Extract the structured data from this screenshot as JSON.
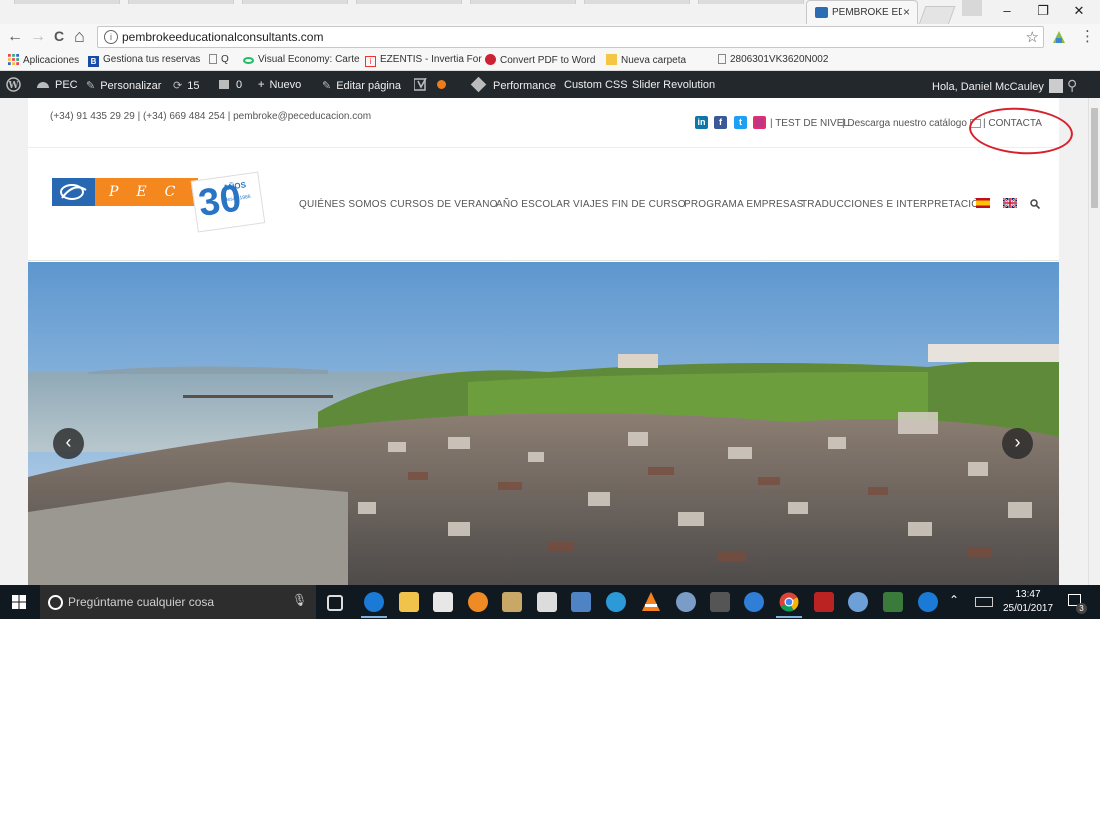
{
  "browser": {
    "tab_title": "PEMBROKE EDU",
    "tab_close": "×",
    "window_controls": {
      "minimize": "–",
      "restore": "❐",
      "close": "✕"
    },
    "nav": {
      "back": "←",
      "forward": "→",
      "reload": "C",
      "home": "⌂"
    },
    "url": "pembrokeeducationalconsultants.com",
    "star": "☆",
    "menu": "⋮"
  },
  "bookmarks": [
    {
      "label": "Aplicaciones",
      "icon": "apps-grid-icon",
      "color": "#e44"
    },
    {
      "label": "Gestiona tus reservas",
      "icon": "booking-icon",
      "color": "#1a4aa8"
    },
    {
      "label": "Q",
      "icon": "page-icon",
      "color": "#888"
    },
    {
      "label": "Visual Economy: Carte",
      "icon": "eye-icon",
      "color": "#2b6"
    },
    {
      "label": "EZENTIS - Invertia For",
      "icon": "invertia-icon",
      "color": "#e33"
    },
    {
      "label": "Convert PDF to Word",
      "icon": "convert-icon",
      "color": "#c23"
    },
    {
      "label": "Nueva carpeta",
      "icon": "folder-icon",
      "color": "#f3c744"
    },
    {
      "label": "2806301VK3620N002",
      "icon": "page-icon",
      "color": "#888"
    }
  ],
  "wp_admin": {
    "site": "PEC",
    "customize": "Personalizar",
    "updates": "15",
    "comments": "0",
    "new": "Nuevo",
    "edit_page": "Editar página",
    "performance": "Performance",
    "custom_css": "Custom CSS",
    "slider": "Slider Revolution",
    "greeting": "Hola, Daniel McCauley"
  },
  "site": {
    "contact_line": "(+34) 91 435 29 29 | (+34) 669 484 254 | pembroke@peceducacion.com",
    "test_nivel": "| TEST DE NIVEL",
    "catalogo": "| Descarga nuestro catálogo",
    "contacta": "| CONTACTA",
    "logo_letters": "PEC",
    "logo_anniv_number": "30",
    "logo_anniv_word": "AÑOS",
    "logo_anniv_sub": "desde 1986",
    "menu": [
      "QUIÉNES SOMOS",
      "CURSOS DE VERANO",
      "AÑO ESCOLAR",
      "VIAJES FIN DE CURSO",
      "PROGRAMA EMPRESAS",
      "TRADUCCIONES E INTERPRETACIÓN"
    ],
    "slider_prev": "‹",
    "slider_next": "›"
  },
  "taskbar": {
    "search_placeholder": "Pregúntame cualquier cosa",
    "time": "13:47",
    "date": "25/01/2017",
    "notifications": "3"
  }
}
